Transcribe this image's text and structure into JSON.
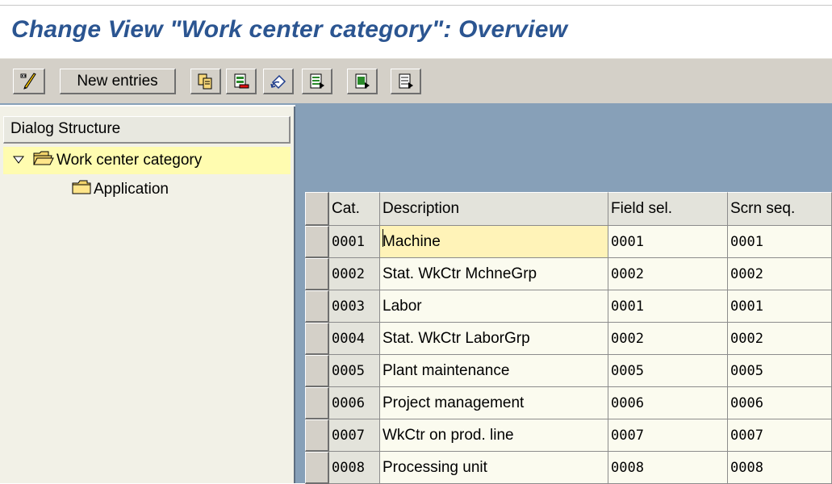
{
  "title": "Change View \"Work center category\": Overview",
  "toolbar": {
    "new_entries_label": "New entries",
    "icons": [
      "display-change-icon",
      "copy-icon",
      "delete-icon",
      "undo-change-icon",
      "select-all-icon",
      "select-block-icon",
      "deselect-all-icon"
    ]
  },
  "dialog_structure": {
    "header": "Dialog Structure",
    "items": [
      {
        "label": "Work center category",
        "expanded": true,
        "selected": true
      },
      {
        "label": "Application",
        "expanded": false,
        "selected": false
      }
    ]
  },
  "table": {
    "columns": [
      "Cat.",
      "Description",
      "Field sel.",
      "Scrn seq."
    ],
    "rows": [
      {
        "cat": "0001",
        "description": "Machine",
        "field_sel": "0001",
        "scrn_seq": "0001"
      },
      {
        "cat": "0002",
        "description": "Stat. WkCtr MchneGrp",
        "field_sel": "0002",
        "scrn_seq": "0002"
      },
      {
        "cat": "0003",
        "description": "Labor",
        "field_sel": "0001",
        "scrn_seq": "0001"
      },
      {
        "cat": "0004",
        "description": "Stat. WkCtr LaborGrp",
        "field_sel": "0002",
        "scrn_seq": "0002"
      },
      {
        "cat": "0005",
        "description": "Plant maintenance",
        "field_sel": "0005",
        "scrn_seq": "0005"
      },
      {
        "cat": "0006",
        "description": "Project management",
        "field_sel": "0006",
        "scrn_seq": "0006"
      },
      {
        "cat": "0007",
        "description": "WkCtr on prod. line",
        "field_sel": "0007",
        "scrn_seq": "0007"
      },
      {
        "cat": "0008",
        "description": "Processing unit",
        "field_sel": "0008",
        "scrn_seq": "0008"
      }
    ]
  },
  "colors": {
    "title": "#2b5591",
    "toolbar_bg": "#d4d0c8",
    "workspace_bg": "#87a0b8",
    "selected_tree_bg": "#fffcb0",
    "focused_cell_bg": "#fff3b8"
  }
}
